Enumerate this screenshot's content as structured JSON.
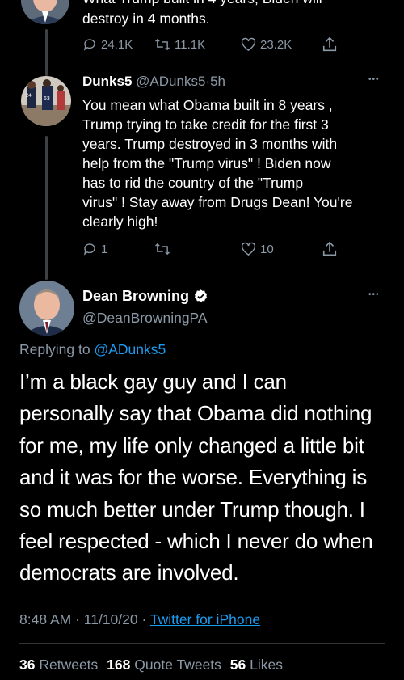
{
  "prev_tweet": {
    "text_top": "What Trump built in 4 years, Biden will",
    "text_line2": "destroy in 4 months.",
    "reply_count": "24.1K",
    "retweet_count": "11.1K",
    "like_count": "23.2K"
  },
  "reply_tweet": {
    "display_name": "Dunks5",
    "handle": "@ADunks5",
    "separator": "·",
    "time": "5h",
    "lines": [
      "You mean what Obama built in 8 years ,",
      "Trump trying to take credit for the first 3",
      "years. Trump destroyed in 3 months with",
      "help from the \"Trump virus\" ! Biden now",
      "has to rid the country of the \"Trump",
      "virus\" ! Stay away from Drugs Dean! You're",
      "clearly high!"
    ],
    "reply_count": "1",
    "retweet_count": "",
    "like_count": "10"
  },
  "main_tweet": {
    "display_name": "Dean Browning",
    "handle": "@DeanBrowningPA",
    "replying_prefix": "Replying to",
    "replying_to": "@ADunks5",
    "lines": [
      "I’m a black gay guy and I can",
      "personally say that Obama did nothing",
      "for me, my life only changed a little bit",
      "and it was for the worse. Everything is",
      "so much better under Trump though. I",
      "feel respected - which I never do when",
      "democrats are involved."
    ],
    "time": "8:48 AM",
    "date": "11/10/20",
    "dot": "·",
    "source": "Twitter for iPhone",
    "retweets_count": "36",
    "retweets_label": "Retweets",
    "quote_count": "168",
    "quote_label": "Quote Tweets",
    "likes_count": "56",
    "likes_label": "Likes"
  },
  "more_icon_text": "•••",
  "colors": {
    "background": "#000000",
    "muted": "#8b98a5",
    "link": "#1d9bf0",
    "verified": "#ffffff"
  }
}
